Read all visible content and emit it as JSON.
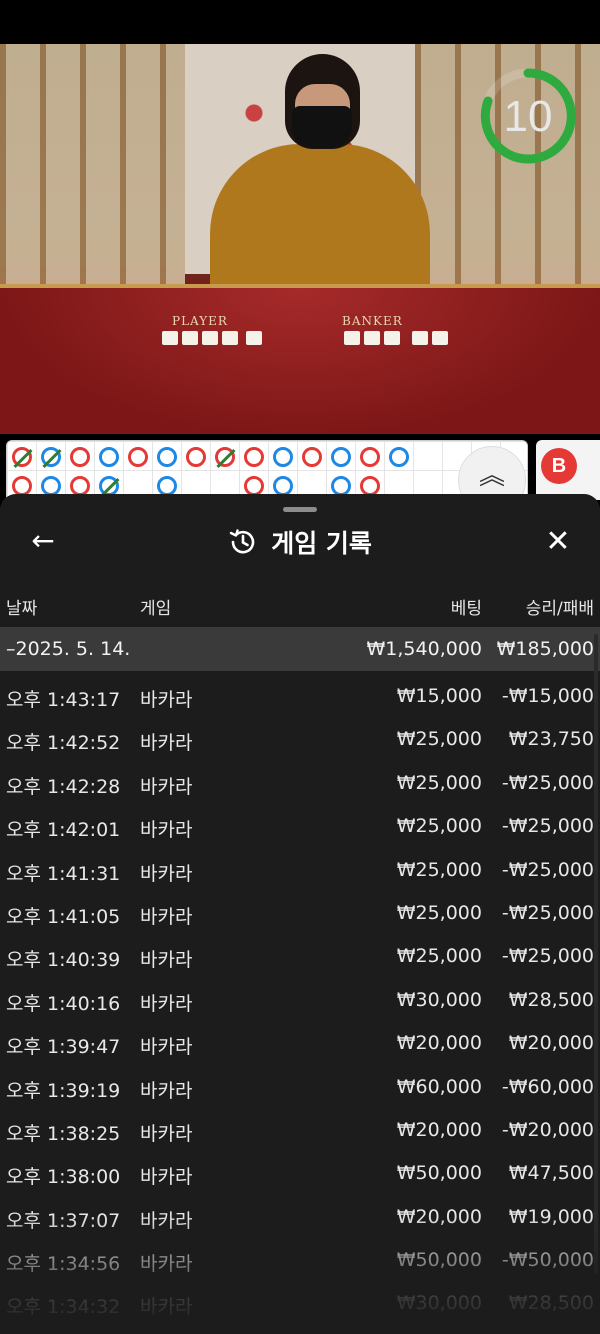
{
  "video": {
    "player_label": "PLAYER",
    "banker_label": "BANKER",
    "timer": "10"
  },
  "roadmap": {
    "scroll_up_glyph": "︽",
    "side_badge": "B"
  },
  "sheet": {
    "title": "게임 기록",
    "back_glyph": "←",
    "close_glyph": "✕",
    "columns": {
      "date": "날짜",
      "game": "게임",
      "bet": "베팅",
      "win_loss": "승리/패배"
    },
    "date_group": {
      "date": "–2025. 5. 14.",
      "bet_total": "₩1,540,000",
      "win_total": "₩185,000"
    },
    "rows": [
      {
        "time": "오후 1:43:17",
        "game": "바카라",
        "bet": "₩15,000",
        "result": "-₩15,000"
      },
      {
        "time": "오후 1:42:52",
        "game": "바카라",
        "bet": "₩25,000",
        "result": "₩23,750"
      },
      {
        "time": "오후 1:42:28",
        "game": "바카라",
        "bet": "₩25,000",
        "result": "-₩25,000"
      },
      {
        "time": "오후 1:42:01",
        "game": "바카라",
        "bet": "₩25,000",
        "result": "-₩25,000"
      },
      {
        "time": "오후 1:41:31",
        "game": "바카라",
        "bet": "₩25,000",
        "result": "-₩25,000"
      },
      {
        "time": "오후 1:41:05",
        "game": "바카라",
        "bet": "₩25,000",
        "result": "-₩25,000"
      },
      {
        "time": "오후 1:40:39",
        "game": "바카라",
        "bet": "₩25,000",
        "result": "-₩25,000"
      },
      {
        "time": "오후 1:40:16",
        "game": "바카라",
        "bet": "₩30,000",
        "result": "₩28,500"
      },
      {
        "time": "오후 1:39:47",
        "game": "바카라",
        "bet": "₩20,000",
        "result": "₩20,000"
      },
      {
        "time": "오후 1:39:19",
        "game": "바카라",
        "bet": "₩60,000",
        "result": "-₩60,000"
      },
      {
        "time": "오후 1:38:25",
        "game": "바카라",
        "bet": "₩20,000",
        "result": "-₩20,000"
      },
      {
        "time": "오후 1:38:00",
        "game": "바카라",
        "bet": "₩50,000",
        "result": "₩47,500"
      },
      {
        "time": "오후 1:37:07",
        "game": "바카라",
        "bet": "₩20,000",
        "result": "₩19,000"
      },
      {
        "time": "오후 1:34:56",
        "game": "바카라",
        "bet": "₩50,000",
        "result": "-₩50,000"
      },
      {
        "time": "오후 1:34:32",
        "game": "바카라",
        "bet": "₩30,000",
        "result": "₩28,500"
      }
    ]
  }
}
